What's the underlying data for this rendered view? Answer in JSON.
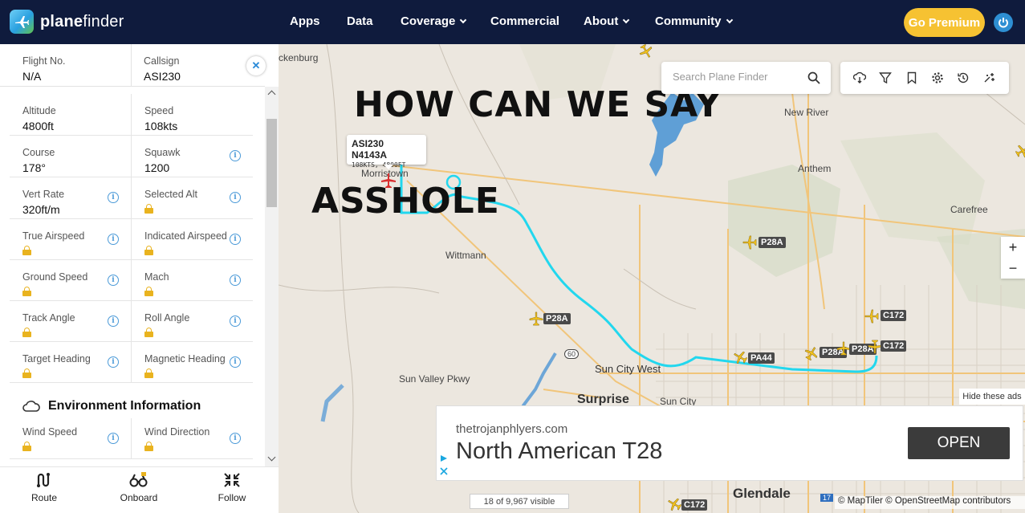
{
  "nav": {
    "logo_plane": "plane",
    "logo_finder": "finder",
    "items": [
      "Apps",
      "Data",
      "Coverage",
      "Commercial",
      "About",
      "Community"
    ],
    "premium_label": "Go Premium"
  },
  "panel": {
    "flight_no_label": "Flight No.",
    "flight_no_value": "N/A",
    "callsign_label": "Callsign",
    "callsign_value": "ASI230",
    "rows": [
      {
        "left_label": "Altitude",
        "left_value": "4800ft",
        "right_label": "Speed",
        "right_value": "108kts"
      },
      {
        "left_label": "Course",
        "left_value": "178°",
        "right_label": "Squawk",
        "right_value": "1200"
      },
      {
        "left_label": "Vert Rate",
        "left_value": "320ft/m",
        "right_label": "Selected Alt",
        "right_value": ""
      },
      {
        "left_label": "True Airspeed",
        "left_value": "",
        "right_label": "Indicated Airspeed",
        "right_value": ""
      },
      {
        "left_label": "Ground Speed",
        "left_value": "",
        "right_label": "Mach",
        "right_value": ""
      },
      {
        "left_label": "Track Angle",
        "left_value": "",
        "right_label": "Roll Angle",
        "right_value": ""
      },
      {
        "left_label": "Target Heading",
        "left_value": "",
        "right_label": "Magnetic Heading",
        "right_value": ""
      }
    ],
    "env_title": "Environment Information",
    "env_row": {
      "left_label": "Wind Speed",
      "right_label": "Wind Direction"
    },
    "bottom": {
      "route": "Route",
      "onboard": "Onboard",
      "follow": "Follow"
    }
  },
  "map": {
    "search_placeholder": "Search Plane Finder",
    "overlay_line1": "HOW CAN WE SAY",
    "overlay_line2": "ASSHOLE",
    "tooltip_title": "ASI230 N4143A",
    "tooltip_sub": "108KTS, 4800FT",
    "places": {
      "wickenburg": "ckenburg",
      "new_river": "New River",
      "anthem": "Anthem",
      "carefree": "Carefree",
      "morristown": "Morristown",
      "wittmann": "Wittmann",
      "sun_valley": "Sun Valley Pkwy",
      "sun_city_west": "Sun City West",
      "surprise": "Surprise",
      "sun_city": "Sun City",
      "glendale": "Glendale",
      "hwy60": "60",
      "hwy17": "17"
    },
    "aircraft_tags": [
      "P28A",
      "P28A",
      "PA44",
      "P28A",
      "P28A",
      "C172",
      "C172",
      "C172"
    ],
    "zoom_in": "+",
    "zoom_out": "−",
    "hide_ads": "Hide these ads",
    "visible_count": "18 of 9,967 visible",
    "attribution": "© MapTiler © OpenStreetMap contributors"
  },
  "ad": {
    "domain": "thetrojanphlyers.com",
    "title": "North American T28",
    "open_label": "OPEN"
  },
  "colors": {
    "nav_bg": "#0f1b3d",
    "premium": "#f6c232",
    "track": "#22d7ee",
    "lake": "#5f9fd6",
    "info_blue": "#4b9ad8",
    "lock_gold": "#e9b31f"
  }
}
